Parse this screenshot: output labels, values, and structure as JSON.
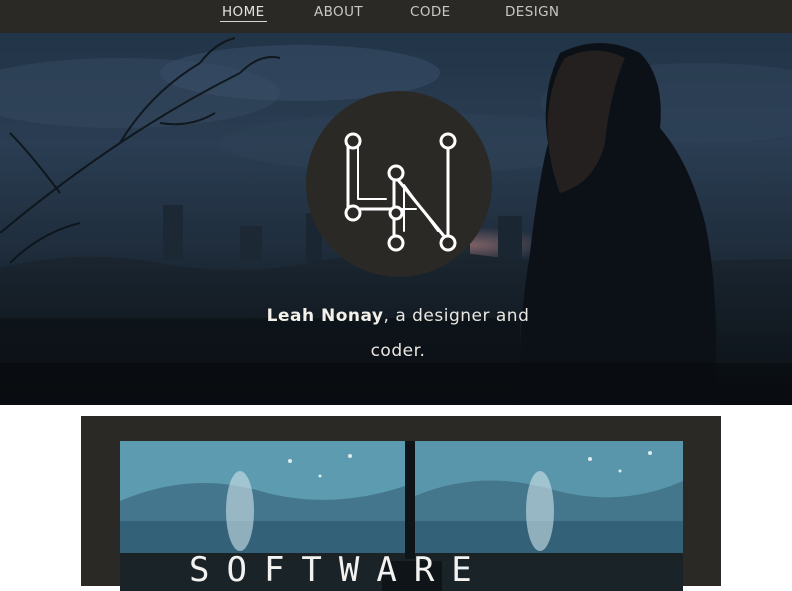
{
  "nav": {
    "items": [
      {
        "label": "HOME",
        "active": true
      },
      {
        "label": "ABOUT",
        "active": false
      },
      {
        "label": "CODE",
        "active": false
      },
      {
        "label": "DESIGN",
        "active": false
      }
    ]
  },
  "hero": {
    "logo": {
      "initials": "LN",
      "icon": "ln-monogram-logo"
    },
    "tagline": {
      "name": "Leah Nonay",
      "rest": ", a designer and coder."
    }
  },
  "card": {
    "title": "SOFTWARE"
  },
  "colors": {
    "nav_background": "#2a2926",
    "logo_circle": "#2a2926",
    "card_background": "#2a2926"
  }
}
